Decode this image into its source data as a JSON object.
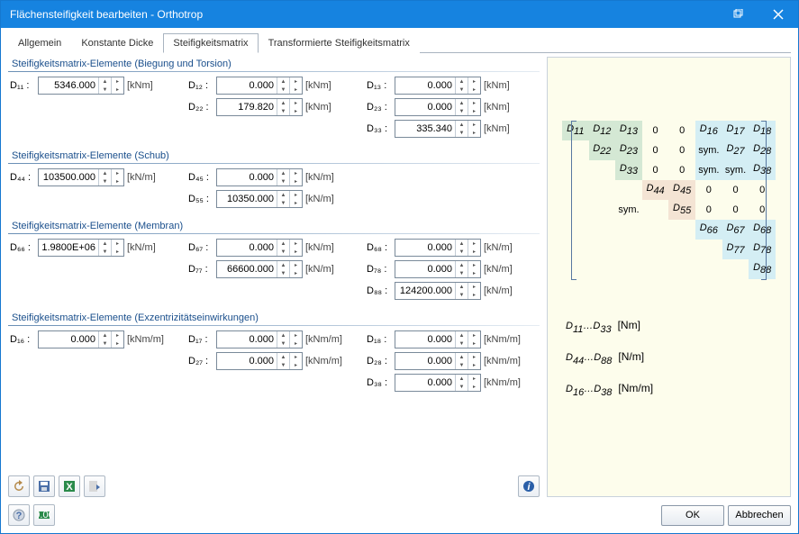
{
  "title": "Flächensteifigkeit bearbeiten - Orthotrop",
  "tabs": [
    "Allgemein",
    "Konstante Dicke",
    "Steifigkeitsmatrix",
    "Transformierte Steifigkeitsmatrix"
  ],
  "active_tab": 2,
  "groups": {
    "bending": {
      "title": "Steifigkeitsmatrix-Elemente (Biegung und Torsion)",
      "u": "[kNm]"
    },
    "shear": {
      "title": "Steifigkeitsmatrix-Elemente (Schub)",
      "u": "[kN/m]"
    },
    "membrane": {
      "title": "Steifigkeitsmatrix-Elemente (Membran)",
      "u": "[kN/m]"
    },
    "ecc": {
      "title": "Steifigkeitsmatrix-Elemente (Exzentrizitätseinwirkungen)",
      "u": "[kNm/m]"
    }
  },
  "fields": {
    "D11": "5346.000",
    "D12": "0.000",
    "D13": "0.000",
    "D22": "179.820",
    "D23": "0.000",
    "D33": "335.340",
    "D44": "103500.000",
    "D45": "0.000",
    "D55": "10350.000",
    "D66": "1.9800E+06",
    "D67": "0.000",
    "D68": "0.000",
    "D77": "66600.000",
    "D78": "0.000",
    "D88": "124200.000",
    "D16": "0.000",
    "D17": "0.000",
    "D18": "0.000",
    "D27": "0.000",
    "D28": "0.000",
    "D38": "0.000"
  },
  "labels": {
    "D11": "D₁₁ :",
    "D12": "D₁₂ :",
    "D13": "D₁₃ :",
    "D22": "D₂₂ :",
    "D23": "D₂₃ :",
    "D33": "D₃₃ :",
    "D44": "D₄₄ :",
    "D45": "D₄₅ :",
    "D55": "D₅₅ :",
    "D66": "D₆₆ :",
    "D67": "D₆₇ :",
    "D68": "D₆₈ :",
    "D77": "D₇₇ :",
    "D78": "D₇₈ :",
    "D88": "D₈₈ :",
    "D16": "D₁₆ :",
    "D17": "D₁₇ :",
    "D18": "D₁₈ :",
    "D27": "D₂₇ :",
    "D28": "D₂₈ :",
    "D38": "D₃₈ :"
  },
  "matrix_legend": {
    "l1a": "D",
    "l1b": "11",
    "l1c": "…D",
    "l1d": "33",
    "l1u": "[Nm]",
    "l2a": "D",
    "l2b": "44",
    "l2c": "…D",
    "l2d": "88",
    "l2u": "[N/m]",
    "l3a": "D",
    "l3b": "16",
    "l3c": "…D",
    "l3d": "38",
    "l3u": "[Nm/m]"
  },
  "buttons": {
    "ok": "OK",
    "cancel": "Abbrechen"
  }
}
